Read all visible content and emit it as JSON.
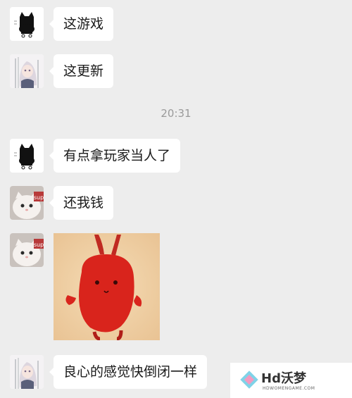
{
  "messages": [
    {
      "avatar": "black-cat-avatar",
      "text": "这游戏"
    },
    {
      "avatar": "anime-girl-avatar",
      "text": "这更新"
    },
    {
      "avatar": "black-cat-avatar",
      "text": "有点拿玩家当人了"
    },
    {
      "avatar": "white-cat-avatar",
      "text": "还我钱"
    },
    {
      "avatar": "white-cat-avatar",
      "sticker": "red-rabbit-sticker"
    },
    {
      "avatar": "anime-girl-avatar",
      "text": "良心的感觉快倒闭一样"
    }
  ],
  "timestamp": "20:31",
  "avatar_labels": {
    "white_cat_sign": "sup"
  },
  "watermark": {
    "brand": "Hd沃梦",
    "sub": "HDWOMENGAME.COM"
  },
  "colors": {
    "background": "#ededed",
    "bubble": "#ffffff",
    "timestamp": "#9a9a9a",
    "sticker_red": "#d9241c"
  }
}
